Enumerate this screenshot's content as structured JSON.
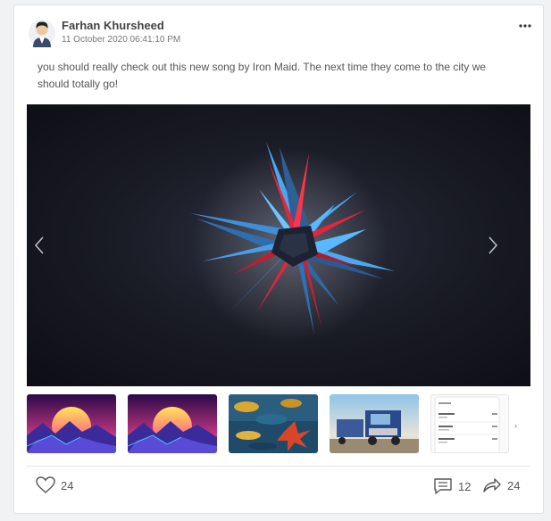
{
  "post": {
    "author": "Farhan Khursheed",
    "timestamp": "11 October 2020 06:41:10 PM",
    "text": "you should really check out this new song by Iron Maid. The next time they come to the city we should totally go!",
    "more_icon": "ellipsis-horizontal-icon"
  },
  "gallery": {
    "main_image": "abstract-star-art",
    "thumbnails": [
      {
        "name": "synthwave-sunset-mountains"
      },
      {
        "name": "synthwave-sunset-mountains"
      },
      {
        "name": "autumn-leaves-water"
      },
      {
        "name": "truck-on-highway"
      },
      {
        "name": "mobile-app-screenshot"
      }
    ],
    "prev_icon": "chevron-left-icon",
    "next_icon": "chevron-right-icon"
  },
  "actions": {
    "likes": "24",
    "comments": "12",
    "shares": "24"
  },
  "colors": {
    "accent_blue": "#4aa8f0",
    "accent_red": "#e8243c",
    "text": "#555555"
  }
}
